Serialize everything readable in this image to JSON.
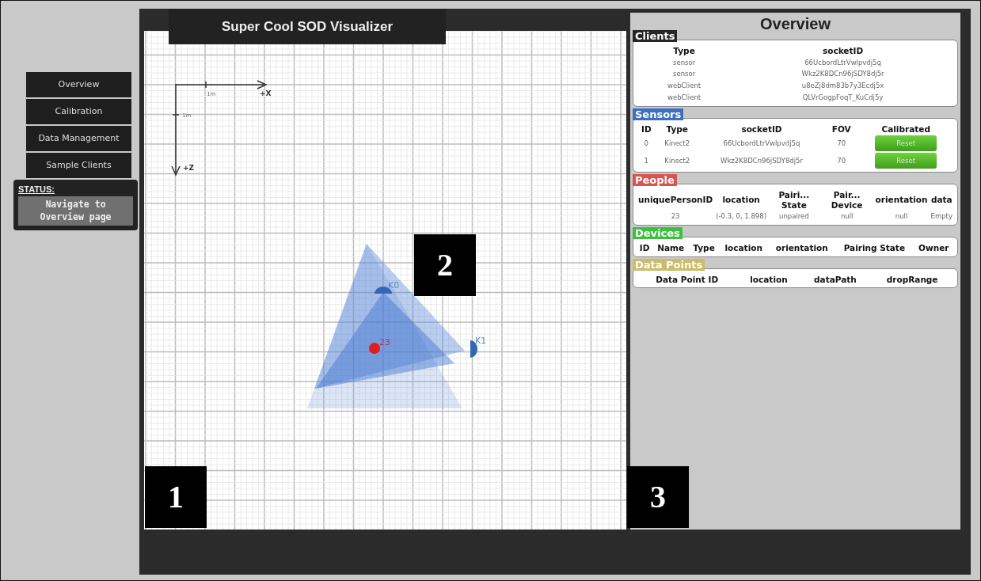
{
  "title": "Super Cool SOD Visualizer",
  "nav": [
    {
      "label": "Overview"
    },
    {
      "label": "Calibration"
    },
    {
      "label": "Data Management"
    },
    {
      "label": "Sample Clients"
    }
  ],
  "status": {
    "label": "STATUS:",
    "message": "Navigate to Overview page"
  },
  "canvas": {
    "x_axis": {
      "label": "+X",
      "tick": "1m"
    },
    "z_axis": {
      "label": "+Z",
      "tick": "1m"
    },
    "sensors": [
      {
        "label": "K0"
      },
      {
        "label": "K1"
      }
    ],
    "people": [
      {
        "label": "23"
      }
    ]
  },
  "overview": {
    "title": "Overview",
    "sections": [
      {
        "title": "Clients",
        "color": "#262626",
        "columns": [
          "Type",
          "socketID"
        ],
        "rows": [
          {
            "cells": [
              "sensor",
              "66UcbordLtrVwlpvdj5q"
            ]
          },
          {
            "cells": [
              "sensor",
              "Wkz2K8DCn96jSDY8dj5r"
            ]
          },
          {
            "cells": [
              "webClient",
              "u8eZj8dm83b7y3Ecdj5x"
            ]
          },
          {
            "cells": [
              "webClient",
              "QLVrGogpFoqT_KuCdj5y"
            ]
          }
        ]
      },
      {
        "title": "Sensors",
        "color": "#3b6fc0",
        "columns": [
          "ID",
          "Type",
          "socketID",
          "FOV",
          "Calibrated"
        ],
        "rows": [
          {
            "cells": [
              "0",
              "Kinect2",
              "66UcbordLtrVwlpvdj5q",
              "70"
            ],
            "button": "Reset"
          },
          {
            "cells": [
              "1",
              "Kinect2",
              "Wkz2K8DCn96jSDY8dj5r",
              "70"
            ],
            "button": "Reset"
          }
        ]
      },
      {
        "title": "People",
        "color": "#d9534f",
        "columns": [
          "uniquePersonID",
          "location",
          "Pairi... State",
          "Pair... Device",
          "orientation",
          "data"
        ],
        "rows": [
          {
            "cells": [
              "23",
              "(-0.3, 0, 1.898)",
              "unpaired",
              "null",
              "null",
              "Empty"
            ]
          }
        ]
      },
      {
        "title": "Devices",
        "color": "#3fbf3f",
        "columns": [
          "ID",
          "Name",
          "Type",
          "location",
          "orientation",
          "Pairing State",
          "Owner"
        ]
      },
      {
        "title": "Data Points",
        "color": "#cdbb6a",
        "columns": [
          "Data Point ID",
          "location",
          "dataPath",
          "dropRange"
        ]
      }
    ]
  },
  "markers": [
    "1",
    "2",
    "3"
  ]
}
